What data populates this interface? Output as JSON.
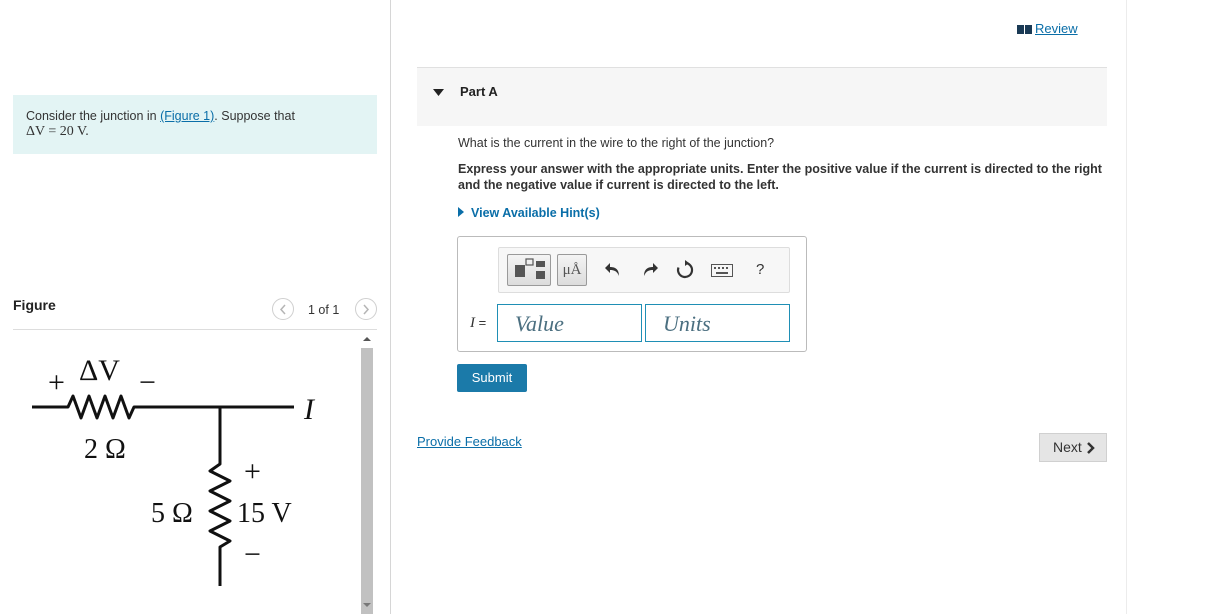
{
  "problem": {
    "intro_prefix": "Consider the junction in ",
    "figure_link": "(Figure 1)",
    "intro_suffix": ". Suppose that",
    "given": "ΔV = 20 V."
  },
  "figure_panel": {
    "title": "Figure",
    "pager": "1 of 1",
    "circuit": {
      "delta_v": "ΔV",
      "plus": "+",
      "minus": "−",
      "resistor_top": "2 Ω",
      "current": "I",
      "resistor_vertical": "5 Ω",
      "battery": "15 V",
      "batt_plus": "+",
      "batt_minus": "−"
    }
  },
  "header": {
    "review": "Review"
  },
  "part": {
    "label": "Part A",
    "question": "What is the current in the wire to the right of the junction?",
    "instructions": "Express your answer with the appropriate units. Enter the positive value if the current is directed to the right and the negative value if current is directed to the left.",
    "hint": "View Available Hint(s)",
    "toolbar": {
      "units_button": "μÅ",
      "help": "?"
    },
    "variable": "I",
    "equals": "=",
    "value_placeholder": "Value",
    "units_placeholder": "Units",
    "submit": "Submit"
  },
  "footer": {
    "feedback": "Provide Feedback",
    "next": "Next"
  },
  "colors": {
    "link": "#0a6ea8",
    "submit": "#1b7aa9",
    "intro_bg": "#e3f4f4",
    "field_border": "#1f8fb5"
  }
}
